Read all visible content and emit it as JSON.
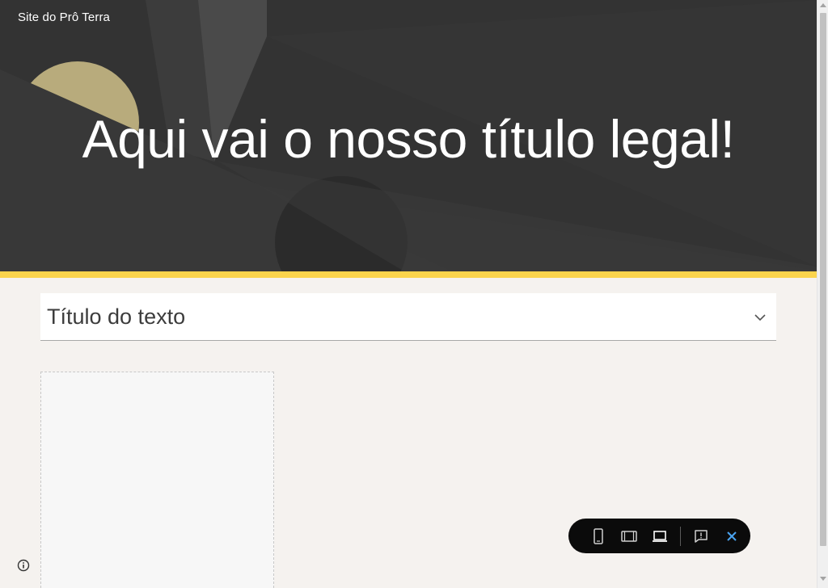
{
  "site": {
    "name": "Site do Prô Terra"
  },
  "hero": {
    "title": "Aqui vai o nosso título legal!"
  },
  "section": {
    "collapsible_title": "Título do texto"
  },
  "toolbar": {
    "icons": [
      "phone-icon",
      "tablet-icon",
      "laptop-icon",
      "feedback-icon",
      "close-icon"
    ]
  },
  "colors": {
    "hero_bg": "#333333",
    "accent": "#fbd44c",
    "page_bg": "#f5f2ef",
    "close_blue": "#4aa3f0"
  }
}
